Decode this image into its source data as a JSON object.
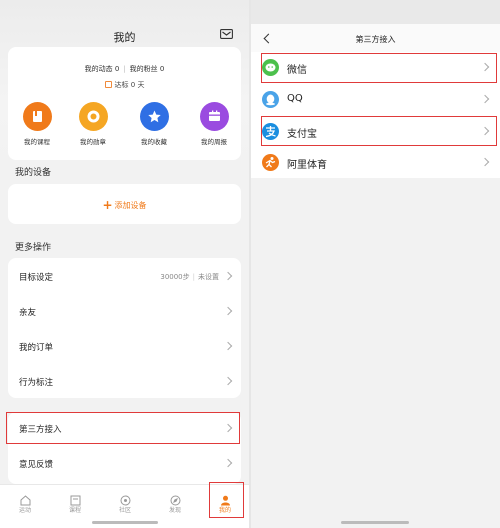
{
  "left": {
    "title": "我的",
    "stats": {
      "dynamics": "我的动态 0",
      "fans": "我的粉丝 0"
    },
    "goal": "达标 0 天",
    "quick_actions": [
      {
        "label": "我的课程",
        "color": "#f07a1a",
        "icon": "course-icon"
      },
      {
        "label": "我的勋章",
        "color": "#f5a623",
        "icon": "medal-icon"
      },
      {
        "label": "我的收藏",
        "color": "#2f6fe4",
        "icon": "star-icon"
      },
      {
        "label": "我的周报",
        "color": "#9a4be0",
        "icon": "report-icon"
      }
    ],
    "devices_label": "我的设备",
    "add_device": "添加设备",
    "more_label": "更多操作",
    "rows": [
      {
        "label": "目标设定",
        "value": "30000步",
        "status": "未设置"
      },
      {
        "label": "亲友"
      },
      {
        "label": "我的订单"
      },
      {
        "label": "行为标注"
      },
      {
        "label": "第三方接入"
      },
      {
        "label": "意见反馈"
      }
    ],
    "tabs": [
      {
        "label": "运动"
      },
      {
        "label": "课程"
      },
      {
        "label": "社区"
      },
      {
        "label": "发现"
      },
      {
        "label": "我的",
        "active": true
      }
    ]
  },
  "right": {
    "title": "第三方接入",
    "items": [
      {
        "name": "微信",
        "color": "#4cc04c",
        "icon": "wechat-icon"
      },
      {
        "name": "QQ",
        "color": "#4aa3e8",
        "icon": "qq-icon"
      },
      {
        "name": "支付宝",
        "color": "#1a8ee0",
        "icon": "alipay-icon"
      },
      {
        "name": "阿里体育",
        "color": "#f07a1a",
        "icon": "alisports-icon"
      }
    ]
  },
  "colors": {
    "accent": "#f07a1a",
    "highlight": "#e03a3a"
  }
}
